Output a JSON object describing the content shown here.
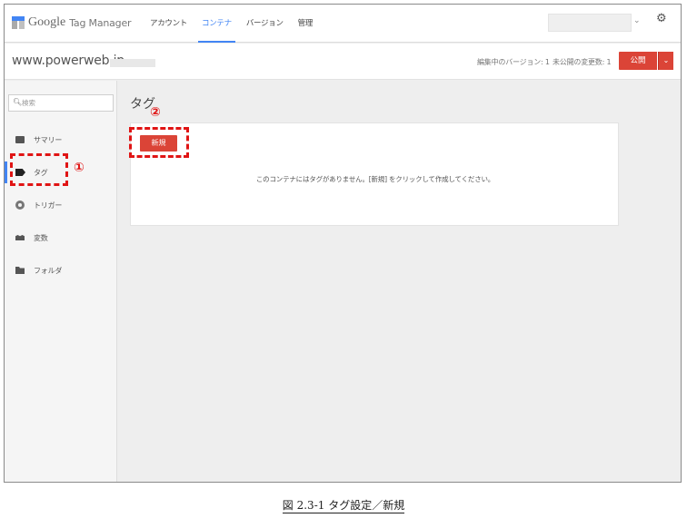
{
  "header": {
    "logo_google": "Google",
    "logo_product": "Tag Manager",
    "nav": [
      {
        "label": "アカウント"
      },
      {
        "label": "コンテナ"
      },
      {
        "label": "バージョン"
      },
      {
        "label": "管理"
      }
    ],
    "active_nav": "コンテナ",
    "account_caret": "⌄",
    "settings_icon": "gear-icon"
  },
  "subheader": {
    "site": "www.powerweb.jp",
    "editing_version": "編集中のバージョン: 1",
    "unpublished_changes": "未公開の変更数: 1",
    "publish_label": "公開",
    "publish_caret": "⌄"
  },
  "sidebar": {
    "search_placeholder": "検索",
    "items": [
      {
        "label": "サマリー",
        "icon": "summary-icon"
      },
      {
        "label": "タグ",
        "icon": "tag-icon"
      },
      {
        "label": "トリガー",
        "icon": "trigger-icon"
      },
      {
        "label": "変数",
        "icon": "variables-icon"
      },
      {
        "label": "フォルダ",
        "icon": "folder-icon"
      }
    ],
    "active": "タグ"
  },
  "main": {
    "title": "タグ",
    "new_label": "新規",
    "empty_message": "このコンテナにはタグがありません。[新規] をクリックして作成してください。"
  },
  "annotations": {
    "marker_1": "①",
    "marker_2": "②",
    "color": "#e01414"
  },
  "colors": {
    "accent_blue": "#4285f4",
    "action_red": "#db4437"
  },
  "caption": "図 2.3-1 タグ設定／新規"
}
